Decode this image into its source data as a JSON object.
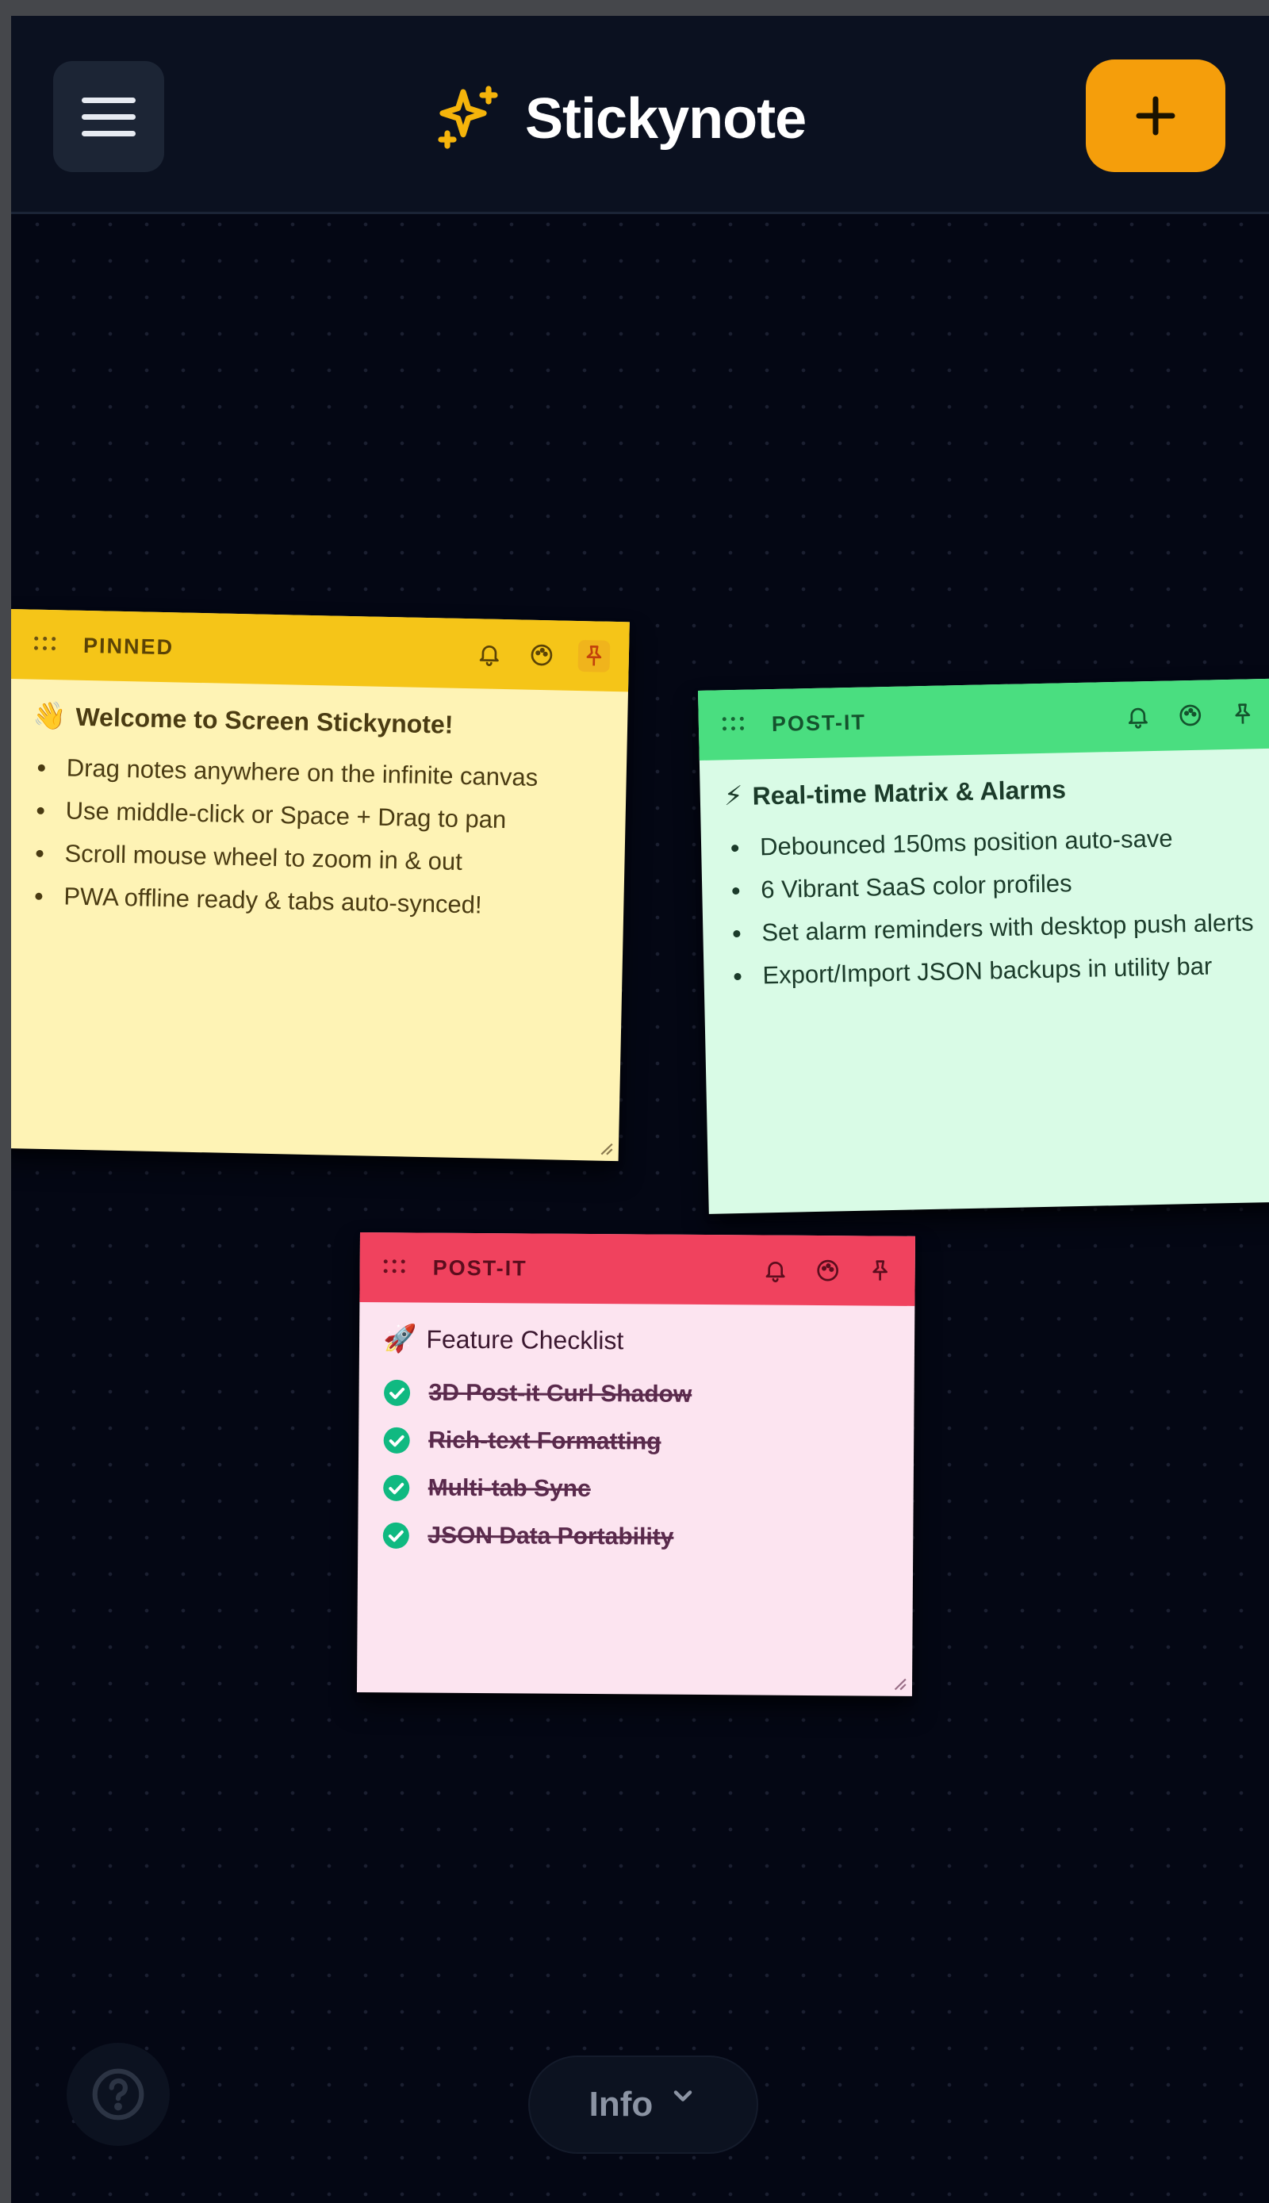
{
  "header": {
    "title": "Stickynote",
    "menu_icon": "hamburger-menu-icon",
    "brand_icon": "sparkles-icon",
    "add_icon": "plus-icon",
    "accent": "#f59e0b"
  },
  "notes": [
    {
      "label": "PINNED",
      "color": "#f5c518",
      "title_emoji": "👋",
      "title": "Welcome to Screen Stickynote!",
      "bullets": [
        "Drag notes anywhere on the infinite canvas",
        "Use middle-click or Space + Drag to pan",
        "Scroll mouse wheel to zoom in & out",
        "PWA offline ready & tabs auto-synced!"
      ],
      "actions": [
        "bell-icon",
        "palette-icon",
        "pin-icon"
      ]
    },
    {
      "label": "POST-IT",
      "color": "#4ade80",
      "title_emoji": "⚡",
      "title": "Real-time Matrix & Alarms",
      "bullets": [
        "Debounced 150ms position auto-save",
        "6 Vibrant SaaS color profiles",
        "Set alarm reminders with desktop push alerts",
        "Export/Import JSON backups in utility bar"
      ],
      "actions": [
        "bell-icon",
        "palette-icon",
        "pin-icon"
      ]
    },
    {
      "label": "POST-IT",
      "color": "#f0425e",
      "title_emoji": "🚀",
      "title": "Feature Checklist",
      "checklist": [
        "3D Post-it Curl Shadow",
        "Rich-text Formatting",
        "Multi-tab Sync",
        "JSON Data Portability"
      ],
      "actions": [
        "bell-icon",
        "palette-icon",
        "pin-icon"
      ]
    }
  ],
  "footer": {
    "help_icon": "help-circle-icon",
    "info_label": "Info",
    "info_icon": "chevron-down-icon"
  }
}
